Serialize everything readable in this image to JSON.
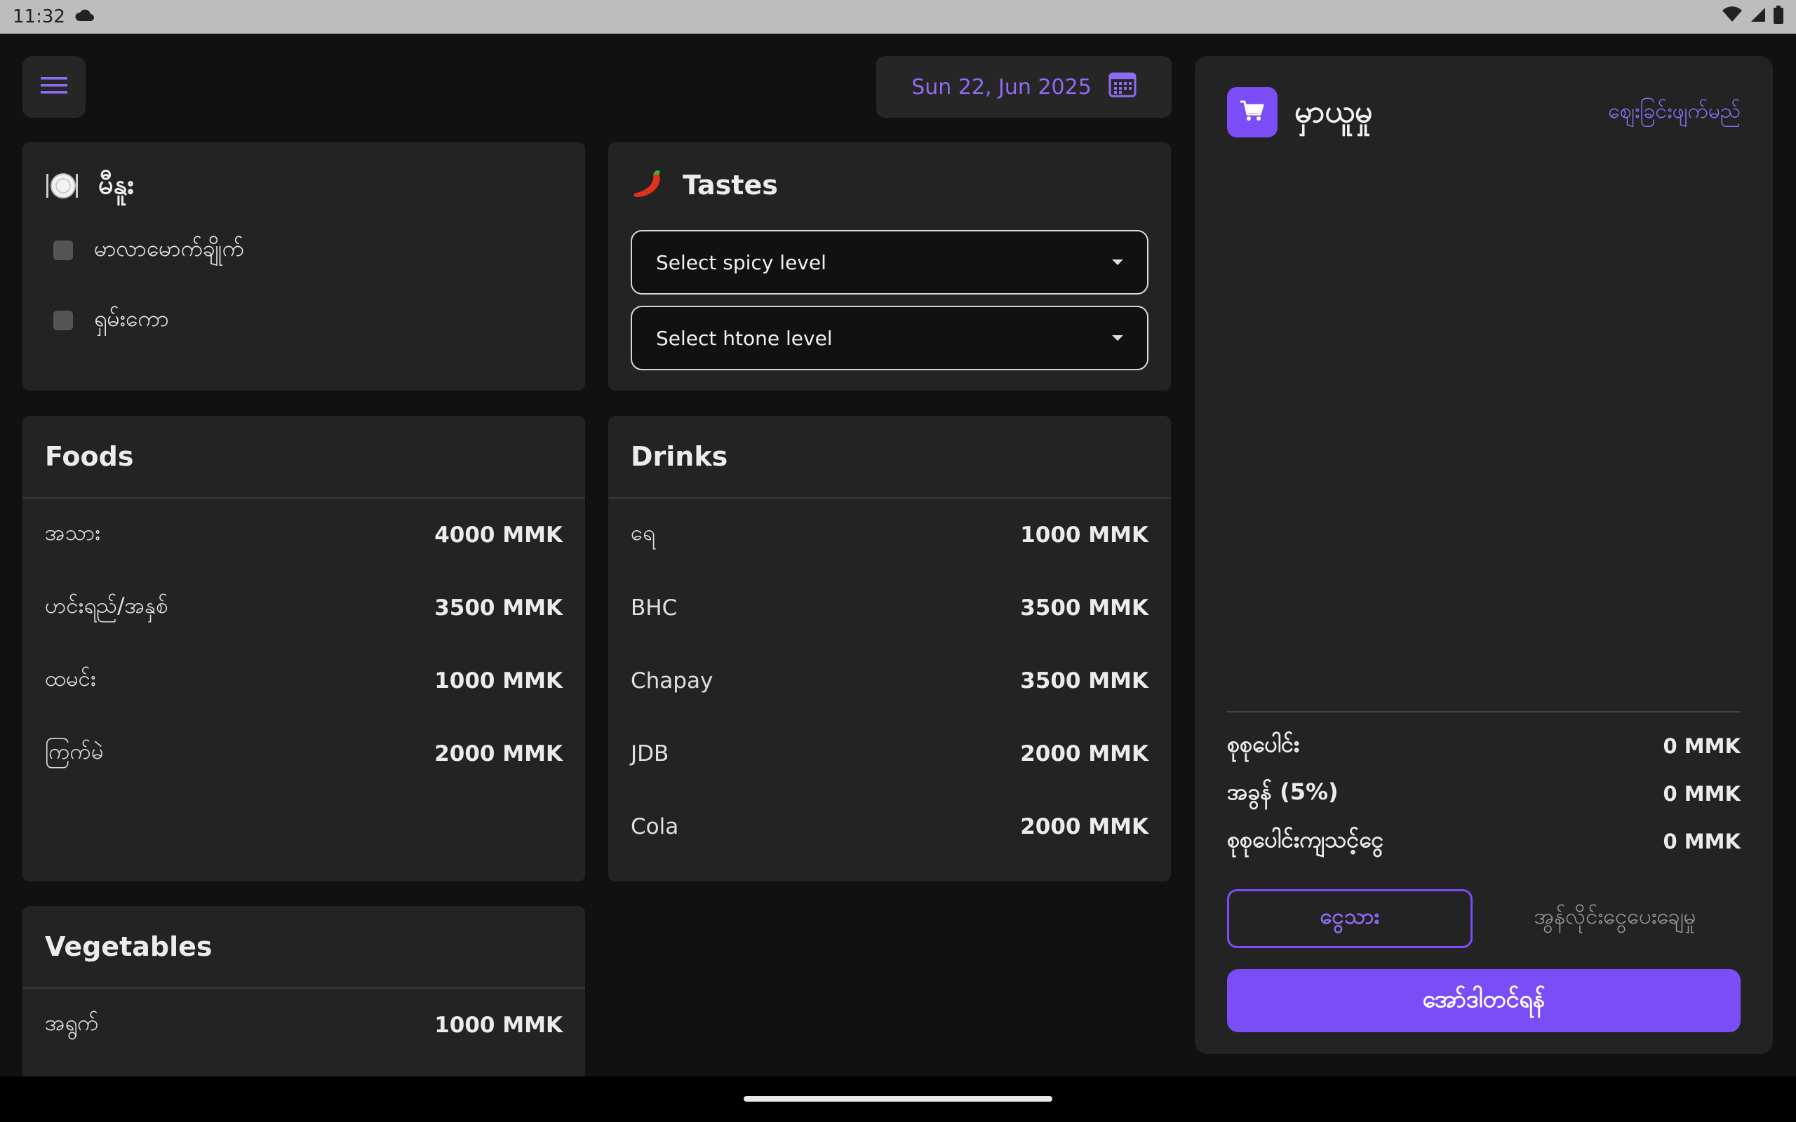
{
  "status": {
    "time": "11:32"
  },
  "header": {
    "date": "Sun 22, Jun 2025"
  },
  "mainDish": {
    "title": "မီနူး",
    "options": [
      {
        "label": "မာလာမောက်ချိုက်"
      },
      {
        "label": "ရှမ်းကော"
      }
    ]
  },
  "tastes": {
    "title": "Tastes",
    "spicy_placeholder": "Select spicy level",
    "htone_placeholder": "Select htone level"
  },
  "foods": {
    "title": "Foods",
    "items": [
      {
        "name": "အသား",
        "price": "4000 MMK"
      },
      {
        "name": "ဟင်းရည်/အနှစ်",
        "price": "3500 MMK"
      },
      {
        "name": "ထမင်း",
        "price": "1000 MMK"
      },
      {
        "name": "ကြက်မဲ",
        "price": "2000 MMK"
      }
    ]
  },
  "drinks": {
    "title": "Drinks",
    "items": [
      {
        "name": "ရေ",
        "price": "1000 MMK"
      },
      {
        "name": "BHC",
        "price": "3500 MMK"
      },
      {
        "name": "Chapay",
        "price": "3500 MMK"
      },
      {
        "name": "JDB",
        "price": "2000 MMK"
      },
      {
        "name": "Cola",
        "price": "2000 MMK"
      }
    ]
  },
  "vegetables": {
    "title": "Vegetables",
    "items": [
      {
        "name": "အရွက်",
        "price": "1000 MMK"
      }
    ]
  },
  "cart": {
    "title": "မှာယူမှု",
    "clear_label": "ဈေးခြင်းဖျက်မည်",
    "subtotal_label": "စုစုပေါင်း",
    "subtotal_value": "0 MMK",
    "tax_label": "အခွန် (5%)",
    "tax_value": "0 MMK",
    "total_label": "စုစုပေါင်းကျသင့်ငွေ",
    "total_value": "0 MMK",
    "pay_cash_label": "ငွေသား",
    "pay_online_label": "အွန်လိုင်းငွေပေးချေမှု",
    "order_label": "အော်ဒါတင်ရန်"
  },
  "colors": {
    "accent": "#7b4df6",
    "accent_text": "#8b6cf2",
    "card": "#232323",
    "background": "#111111"
  },
  "icons": [
    "cloud-icon",
    "wifi-icon",
    "signal-icon",
    "battery-icon",
    "menu-icon",
    "calendar-icon",
    "plate-icon",
    "chili-icon",
    "cart-icon",
    "dropdown-caret-icon"
  ]
}
